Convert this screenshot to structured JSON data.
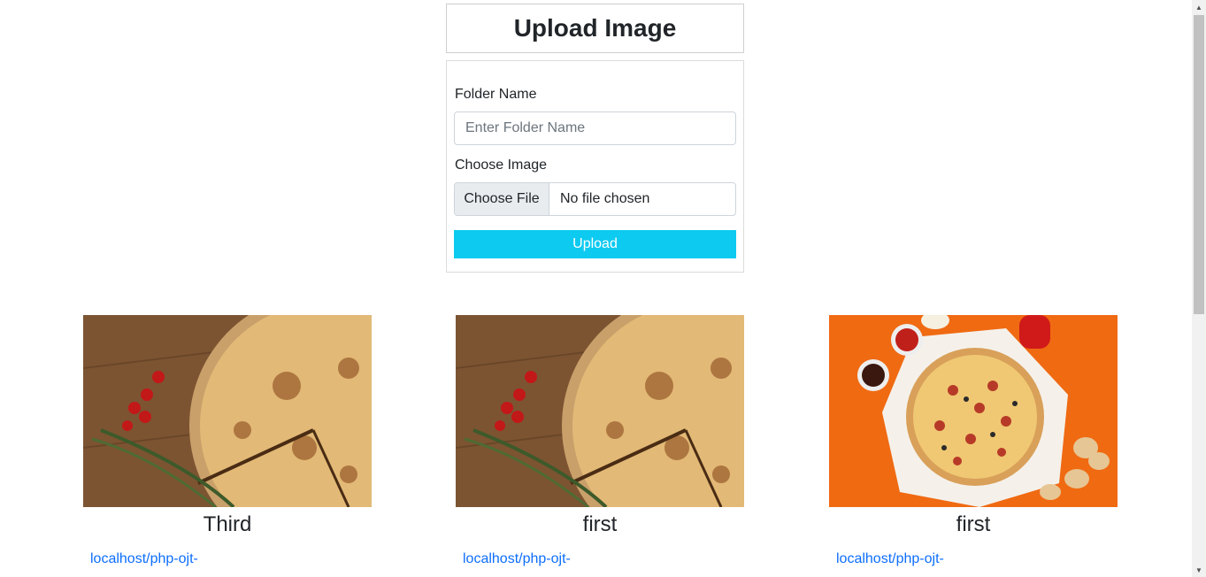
{
  "header": {
    "title": "Upload Image"
  },
  "form": {
    "folder_label": "Folder Name",
    "folder_placeholder": "Enter Folder Name",
    "folder_value": "",
    "image_label": "Choose Image",
    "file_button_label": "Choose File",
    "file_status": "No file chosen",
    "upload_label": "Upload"
  },
  "gallery": [
    {
      "title": "Third",
      "link": "localhost/php-ojt-",
      "image": "pizza-wood-table"
    },
    {
      "title": "first",
      "link": "localhost/php-ojt-",
      "image": "pizza-wood-table"
    },
    {
      "title": "first",
      "link": "localhost/php-ojt-",
      "image": "pizza-orange-background"
    }
  ],
  "colors": {
    "upload_button": "#0dcaf0",
    "link": "#0d6efd"
  }
}
